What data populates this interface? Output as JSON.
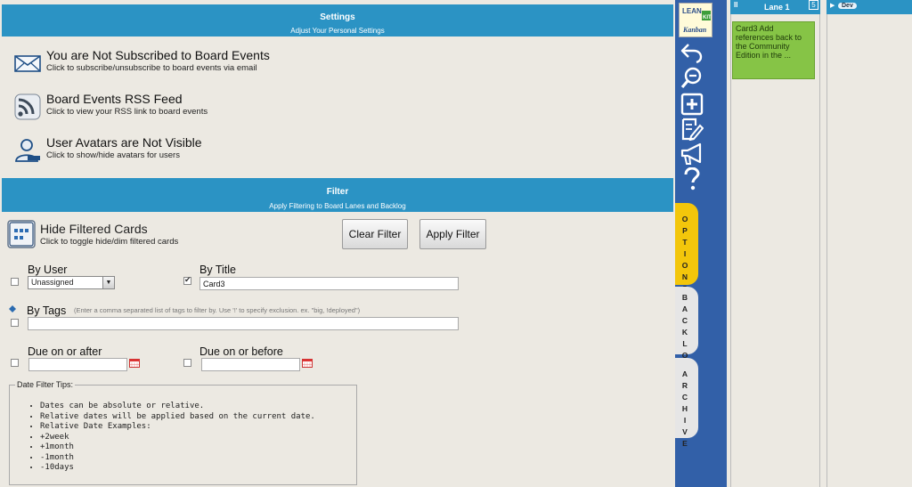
{
  "settings": {
    "title": "Settings",
    "subtitle": "Adjust Your Personal Settings",
    "items": [
      {
        "title": "You are Not Subscribed to Board Events",
        "desc": "Click to subscribe/unsubscribe to board events via email",
        "icon": "envelope-icon"
      },
      {
        "title": "Board Events RSS Feed",
        "desc": "Click to view your RSS link to board events",
        "icon": "rss-icon"
      },
      {
        "title": "User Avatars are Not Visible",
        "desc": "Click to show/hide avatars for users",
        "icon": "user-icon"
      }
    ]
  },
  "filter": {
    "title": "Filter",
    "subtitle": "Apply Filtering to Board Lanes and Backlog",
    "hide_filtered": {
      "title": "Hide Filtered Cards",
      "desc": "Click to toggle hide/dim filtered cards"
    },
    "clear_label": "Clear Filter",
    "apply_label": "Apply Filter",
    "by_user": {
      "label": "By User",
      "value": "Unassigned",
      "checked": false
    },
    "by_title": {
      "label": "By Title",
      "value": "Card3",
      "checked": true
    },
    "by_tags": {
      "label": "By Tags",
      "hint": "(Enter a comma separated list of tags to filter by. Use '!' to specify exclusion. ex. \"big, !deployed\")",
      "value": "",
      "checked": false
    },
    "due_after": {
      "label": "Due on or after",
      "value": "",
      "checked": false
    },
    "due_before": {
      "label": "Due on or before",
      "value": "",
      "checked": false
    },
    "tips": {
      "legend": "Date Filter Tips:",
      "items": [
        "Dates can be absolute or relative.",
        "Relative dates will be applied based on the current date.",
        "Relative Date Examples:",
        "+2week",
        "+1month",
        "-1month",
        "-10days"
      ]
    }
  },
  "sidebar": {
    "logo": {
      "line1": "LEAN",
      "line2": "KIT",
      "line3": "Kanban"
    },
    "tools": [
      "undo-icon",
      "zoom-icon",
      "add-card-icon",
      "edit-icon",
      "announce-icon",
      "help-icon"
    ],
    "tabs": [
      "OPTIONS",
      "BACKLOG",
      "ARCHIVE"
    ]
  },
  "board": {
    "lane1": {
      "title": "Lane 1",
      "pause": "II",
      "count": "5"
    },
    "card": {
      "text": "Card3 Add references back to the Community Edition in the ..."
    },
    "dev_lane": {
      "title": "Dev",
      "arrow": "▶"
    }
  },
  "colors": {
    "header_blue": "#2b93c4",
    "sidebar_blue": "#3260a8",
    "options_tab": "#f3c60b",
    "card_green": "#86c446"
  }
}
